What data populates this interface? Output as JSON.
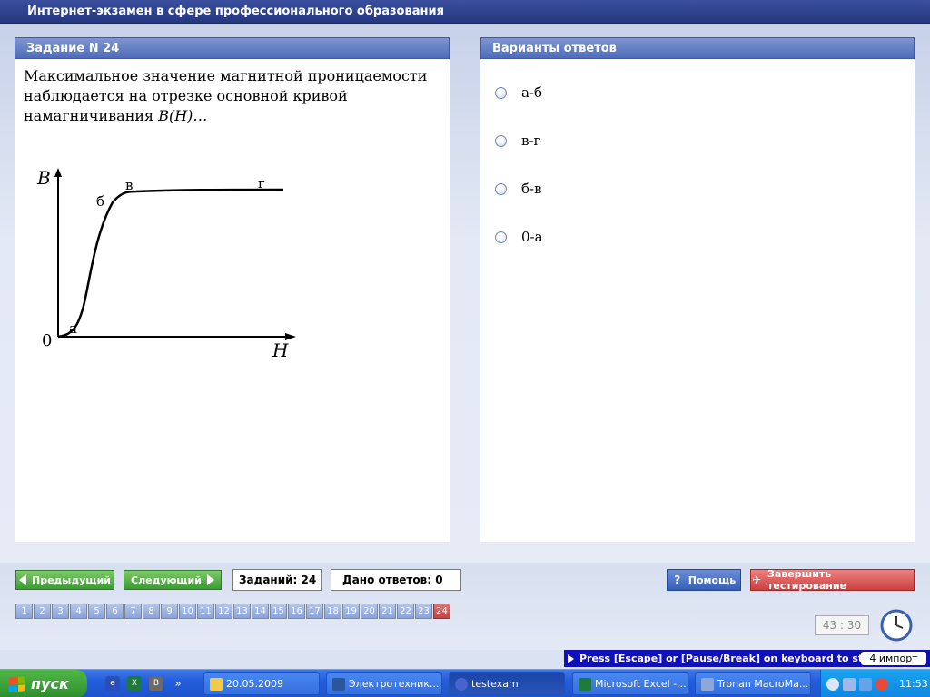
{
  "window": {
    "title": "Интернет-экзамен в сфере профессионального образования"
  },
  "task": {
    "header": "Задание N 24",
    "question_line1": "Максимальное значение магнитной проницаемости",
    "question_line2": "наблюдается на отрезке основной кривой",
    "question_line3_prefix": "намагничивания ",
    "question_formula": "B(H)…",
    "figure": {
      "y_axis_label": "B",
      "x_axis_label": "H",
      "origin_label": "0",
      "point_a": "а",
      "point_b": "б",
      "point_v": "в",
      "point_g": "г"
    }
  },
  "answers": {
    "header": "Варианты ответов",
    "options": [
      "а-б",
      "в-г",
      "б-в",
      "0-а"
    ]
  },
  "toolbar": {
    "prev_label": "Предыдущий",
    "next_label": "Следующий",
    "tasks_count": "Заданий: 24",
    "answered_count": "Дано ответов: 0",
    "help_label": "Помощь",
    "finish_label": "Завершить тестирование",
    "current_question": "24",
    "question_numbers": [
      "1",
      "2",
      "3",
      "4",
      "5",
      "6",
      "7",
      "8",
      "9",
      "10",
      "11",
      "12",
      "13",
      "14",
      "15",
      "16",
      "17",
      "18",
      "19",
      "20",
      "21",
      "22",
      "23",
      "24"
    ],
    "timer": "43 : 30"
  },
  "recorder_bar": {
    "text": "Press [Escape] or [Pause/Break] on keyboard to stop",
    "badge": "4 импорт"
  },
  "taskbar": {
    "start_label": "пуск",
    "tasks": [
      "20.05.2009",
      "Электротехник...",
      "testexam",
      "Microsoft Excel -...",
      "Tronan MacroMa..."
    ],
    "clock": "11:53"
  },
  "colors": {
    "title_bar": "#24377f",
    "panel_header": "#4f6cb8",
    "green_button": "#3d9a33",
    "help_button": "#355fb7",
    "finish_button": "#c94141",
    "active_number": "#c04444",
    "taskbar": "#245ddb"
  }
}
